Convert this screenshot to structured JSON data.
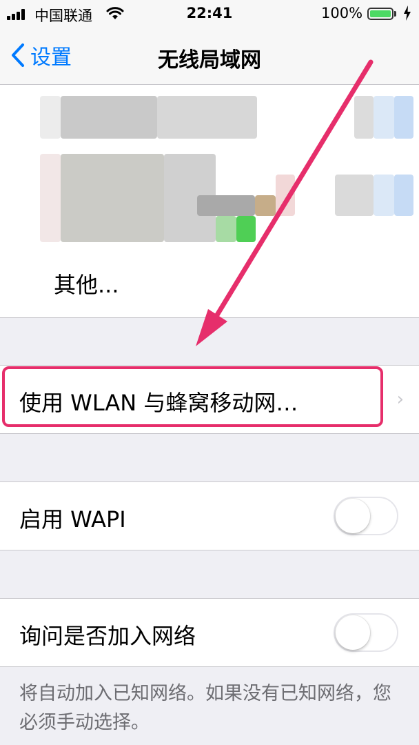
{
  "status_bar": {
    "carrier": "中国联通",
    "time": "22:41",
    "battery_percent": "100%",
    "battery_level": 1.0,
    "icons": [
      "signal-icon",
      "wifi-icon",
      "battery-icon",
      "charging-icon"
    ]
  },
  "nav": {
    "back_label": "设置",
    "title": "无线局域网"
  },
  "networks": {
    "other_label": "其他..."
  },
  "wlan_cellular": {
    "label": "使用 WLAN 与蜂窝移动网…"
  },
  "wapi": {
    "label": "启用 WAPI",
    "enabled": false
  },
  "ask_join": {
    "label": "询问是否加入网络",
    "enabled": false,
    "footer": "将自动加入已知网络。如果没有已知网络，您必须手动选择。"
  },
  "colors": {
    "accent": "#007aff",
    "annotation": "#e62e6b",
    "group_background": "#efeff4"
  }
}
